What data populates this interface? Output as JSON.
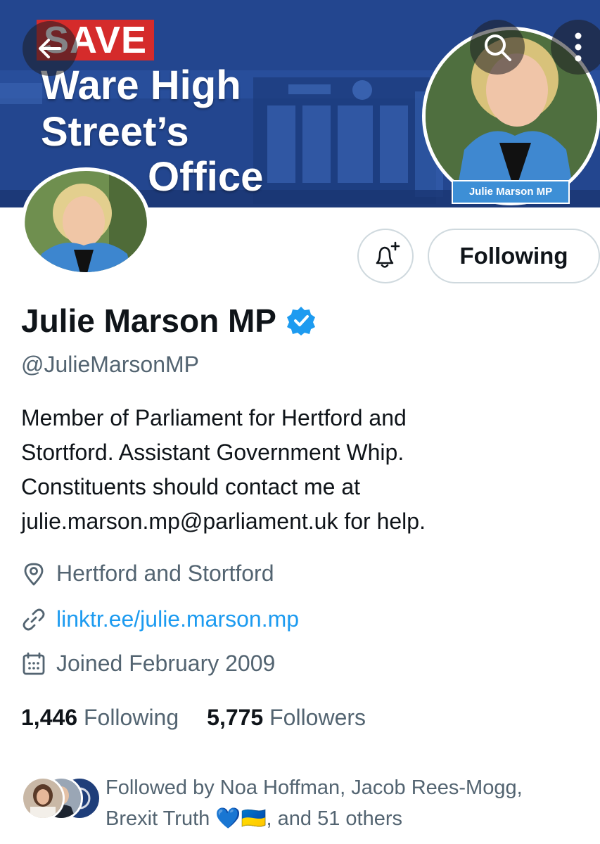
{
  "banner": {
    "save": "SAVE",
    "line1": "Ware High",
    "line2": "Street’s",
    "line3": "Office",
    "photo_label": "Julie Marson MP"
  },
  "icons": {
    "back": "back-arrow-icon",
    "search": "search-icon",
    "more": "more-vertical-icon",
    "notify": "bell-plus-icon",
    "verified": "verified-badge-icon",
    "location": "location-pin-icon",
    "link": "link-icon",
    "calendar": "calendar-icon"
  },
  "actions": {
    "following_label": "Following"
  },
  "profile": {
    "name": "Julie Marson MP",
    "handle": "@JulieMarsonMP",
    "bio_lines": [
      "Member of Parliament for Hertford and",
      "Stortford. Assistant Government Whip.",
      "Constituents should contact me at",
      "julie.marson.mp@parliament.uk for help."
    ],
    "location": "Hertford and Stortford",
    "link": "linktr.ee/julie.marson.mp",
    "joined": "Joined February 2009"
  },
  "stats": {
    "following_count": "1,446",
    "following_label": "Following",
    "followers_count": "5,775",
    "followers_label": "Followers"
  },
  "followed_by": {
    "prefix": "Followed by Noa Hoffman, Jacob Rees-Mogg,",
    "line2_start": "Brexit Truth ",
    "heart": "💙",
    "flag": "🇺🇦",
    "line2_end": ", and 51 others"
  },
  "colors": {
    "accent_link": "#1d9bf0",
    "verified": "#1d9bf0",
    "banner_blue": "#254a96",
    "save_red": "#d52b2b",
    "muted": "#536471"
  }
}
